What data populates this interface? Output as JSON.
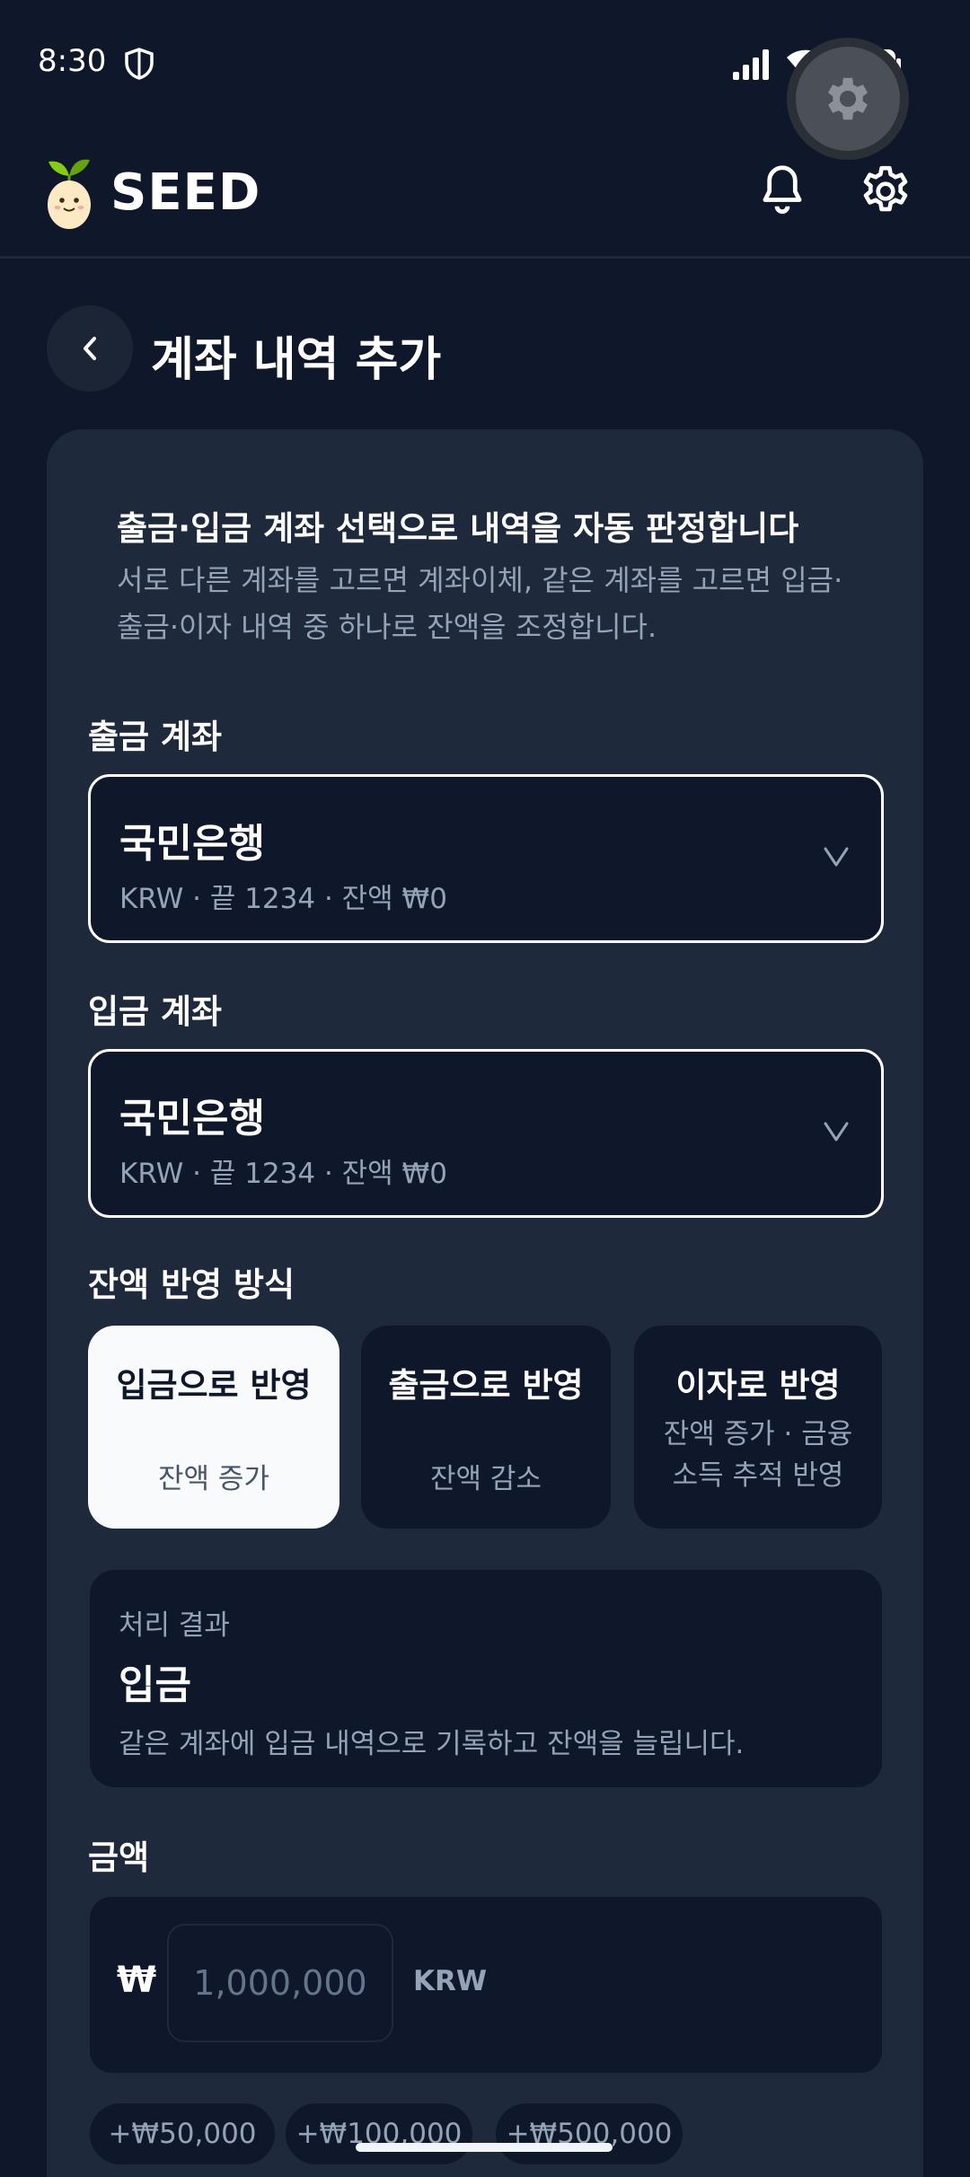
{
  "status_bar": {
    "time": "8:30"
  },
  "app_bar": {
    "brand": "SEED"
  },
  "page": {
    "title": "계좌 내역 추가"
  },
  "info": {
    "title": "출금·입금 계좌 선택으로 내역을 자동 판정합니다",
    "description": "서로 다른 계좌를 고르면 계좌이체, 같은 계좌를 고르면 입금·출금·이자 내역 중 하나로 잔액을 조정합니다."
  },
  "withdraw_account": {
    "label": "출금 계좌",
    "name": "국민은행",
    "meta": "KRW · 끝 1234 · 잔액 ₩0"
  },
  "deposit_account": {
    "label": "입금 계좌",
    "name": "국민은행",
    "meta": "KRW · 끝 1234 · 잔액 ₩0"
  },
  "balance_method": {
    "label": "잔액 반영 방식",
    "options": [
      {
        "title": "입금으로 반영",
        "subtitle": "잔액 증가",
        "selected": true
      },
      {
        "title": "출금으로 반영",
        "subtitle": "잔액 감소",
        "selected": false
      },
      {
        "title": "이자로 반영",
        "subtitle_line1": "잔액 증가 · 금융",
        "subtitle_line2": "소득 추적 반영",
        "selected": false
      }
    ]
  },
  "result": {
    "label": "처리 결과",
    "value": "입금",
    "description": "같은 계좌에 입금 내역으로 기록하고 잔액을 늘립니다."
  },
  "amount": {
    "label": "금액",
    "symbol": "₩",
    "placeholder": "1,000,000",
    "currency": "KRW"
  },
  "quick_add": [
    "+₩50,000",
    "+₩100,000",
    "+₩500,000"
  ],
  "colors": {
    "background": "#0f172a",
    "card": "#1e293b",
    "muted_text": "#94a3b8",
    "selected_option": "#f8fafc"
  }
}
